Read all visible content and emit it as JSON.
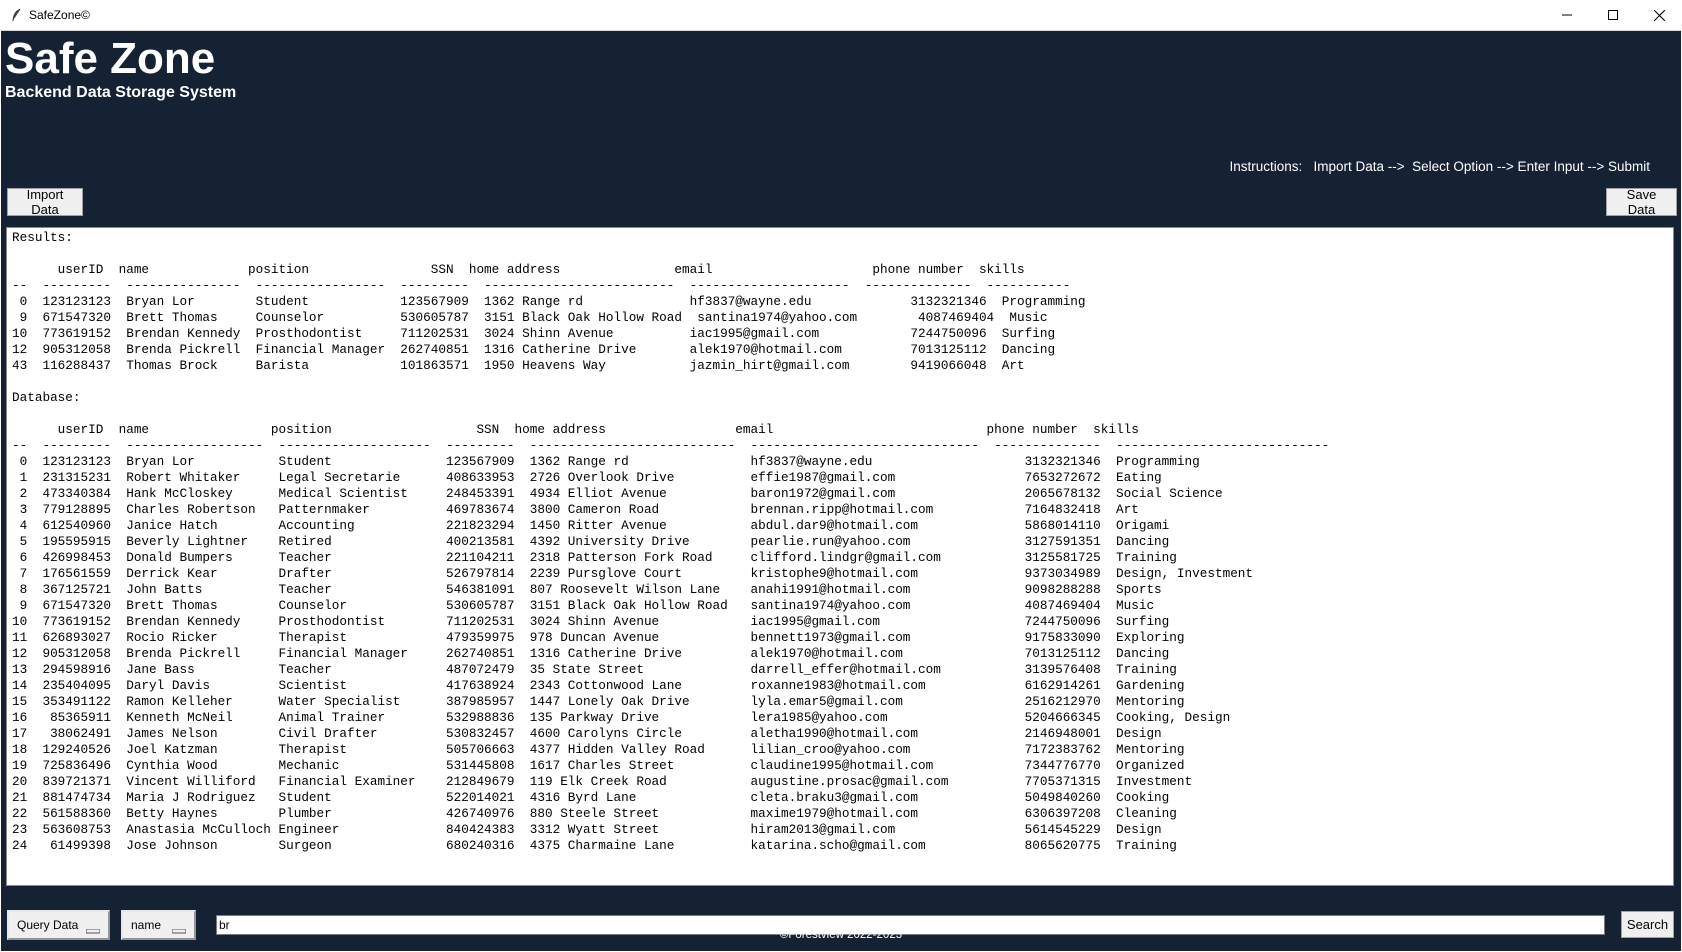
{
  "window": {
    "title": "SafeZone©",
    "icon": "feather-icon"
  },
  "header": {
    "title": "Safe Zone",
    "subtitle": "Backend Data Storage System",
    "instructions": "Instructions:   Import Data -->  Select Option --> Enter Input --> Submit"
  },
  "toolbar": {
    "import_label": "Import Data",
    "save_label": "Save Data"
  },
  "output_text": "Results:\n\n      userID  name             position                SSN  home address               email                     phone number  skills\n--  ---------  ---------------  -----------------  ---------  -------------------------  ---------------------  --------------  -----------\n 0  123123123  Bryan Lor        Student            123567909  1362 Range rd              hf3837@wayne.edu             3132321346  Programming\n 9  671547320  Brett Thomas     Counselor          530605787  3151 Black Oak Hollow Road  santina1974@yahoo.com        4087469404  Music\n10  773619152  Brendan Kennedy  Prosthodontist     711202531  3024 Shinn Avenue          iac1995@gmail.com            7244750096  Surfing\n12  905312058  Brenda Pickrell  Financial Manager  262740851  1316 Catherine Drive       alek1970@hotmail.com         7013125112  Dancing\n43  116288437  Thomas Brock     Barista            101863571  1950 Heavens Way           jazmin_hirt@gmail.com        9419066048  Art\n\nDatabase:\n\n      userID  name                position                   SSN  home address                 email                            phone number  skills\n--  ---------  ------------------  --------------------  ---------  ---------------------------  ------------------------------  --------------  ----------------------------\n 0  123123123  Bryan Lor           Student               123567909  1362 Range rd                hf3837@wayne.edu                    3132321346  Programming\n 1  231315231  Robert Whitaker     Legal Secretarie      408633953  2726 Overlook Drive          effie1987@gmail.com                 7653272672  Eating\n 2  473340384  Hank McCloskey      Medical Scientist     248453391  4934 Elliot Avenue           baron1972@gmail.com                 2065678132  Social Science\n 3  779128895  Charles Robertson   Patternmaker          469783674  3800 Cameron Road            brennan.ripp@hotmail.com            7164832418  Art\n 4  612540960  Janice Hatch        Accounting            221823294  1450 Ritter Avenue           abdul.dar9@hotmail.com              5868014110  Origami\n 5  195595915  Beverly Lightner    Retired               400213581  4392 University Drive        pearlie.run@yahoo.com               3127591351  Dancing\n 6  426998453  Donald Bumpers      Teacher               221104211  2318 Patterson Fork Road     clifford.lindgr@gmail.com           3125581725  Training\n 7  176561559  Derrick Kear        Drafter               526797814  2239 Pursglove Court         kristophe9@hotmail.com              9373034989  Design, Investment\n 8  367125721  John Batts          Teacher               546381091  807 Roosevelt Wilson Lane    anahi1991@hotmail.com               9098288288  Sports\n 9  671547320  Brett Thomas        Counselor             530605787  3151 Black Oak Hollow Road   santina1974@yahoo.com               4087469404  Music\n10  773619152  Brendan Kennedy     Prosthodontist        711202531  3024 Shinn Avenue            iac1995@gmail.com                   7244750096  Surfing\n11  626893027  Rocio Ricker        Therapist             479359975  978 Duncan Avenue            bennett1973@gmail.com               9175833090  Exploring\n12  905312058  Brenda Pickrell     Financial Manager     262740851  1316 Catherine Drive         alek1970@hotmail.com                7013125112  Dancing\n13  294598916  Jane Bass           Teacher               487072479  35 State Street              darrell_effer@hotmail.com           3139576408  Training\n14  235404095  Daryl Davis         Scientist             417638924  2343 Cottonwood Lane         roxanne1983@hotmail.com             6162914261  Gardening\n15  353491122  Ramon Kelleher      Water Specialist      387985957  1447 Lonely Oak Drive        lyla.emar5@gmail.com                2516212970  Mentoring\n16   85365911  Kenneth McNeil      Animal Trainer        532988836  135 Parkway Drive            lera1985@yahoo.com                  5204666345  Cooking, Design\n17   38062491  James Nelson        Civil Drafter         530832457  4600 Carolyns Circle         aletha1990@hotmail.com              2146948001  Design\n18  129240526  Joel Katzman        Therapist             505706663  4377 Hidden Valley Road      lilian_croo@yahoo.com               7172383762  Mentoring\n19  725836496  Cynthia Wood        Mechanic              531445808  1617 Charles Street          claudine1995@hotmail.com            7344776770  Organized\n20  839721371  Vincent Williford   Financial Examiner    212849679  119 Elk Creek Road           augustine.prosac@gmail.com          7705371315  Investment\n21  881474734  Maria J Rodriguez   Student               522014021  4316 Byrd Lane               cleta.braku3@gmail.com              5049840260  Cooking\n22  561588360  Betty Haynes        Plumber               426740976  880 Steele Street            maxime1979@hotmail.com              6306397208  Cleaning\n23  563608753  Anastasia McCulloch Engineer              840424383  3312 Wyatt Street            hiram2013@gmail.com                 5614545229  Design\n24   61499398  Jose Johnson        Surgeon               680240316  4375 Charmaine Lane          katarina.scho@gmail.com             8065620775  Training",
  "controls": {
    "query_menu_label": "Query Data",
    "field_menu_label": "name",
    "search_value": "br",
    "search_label": "Search"
  },
  "footer": {
    "text": "©Forestview 2022-2023"
  },
  "colors": {
    "app_background": "#142234",
    "text_light": "#ffffff",
    "button_face": "#f0f0f0"
  }
}
